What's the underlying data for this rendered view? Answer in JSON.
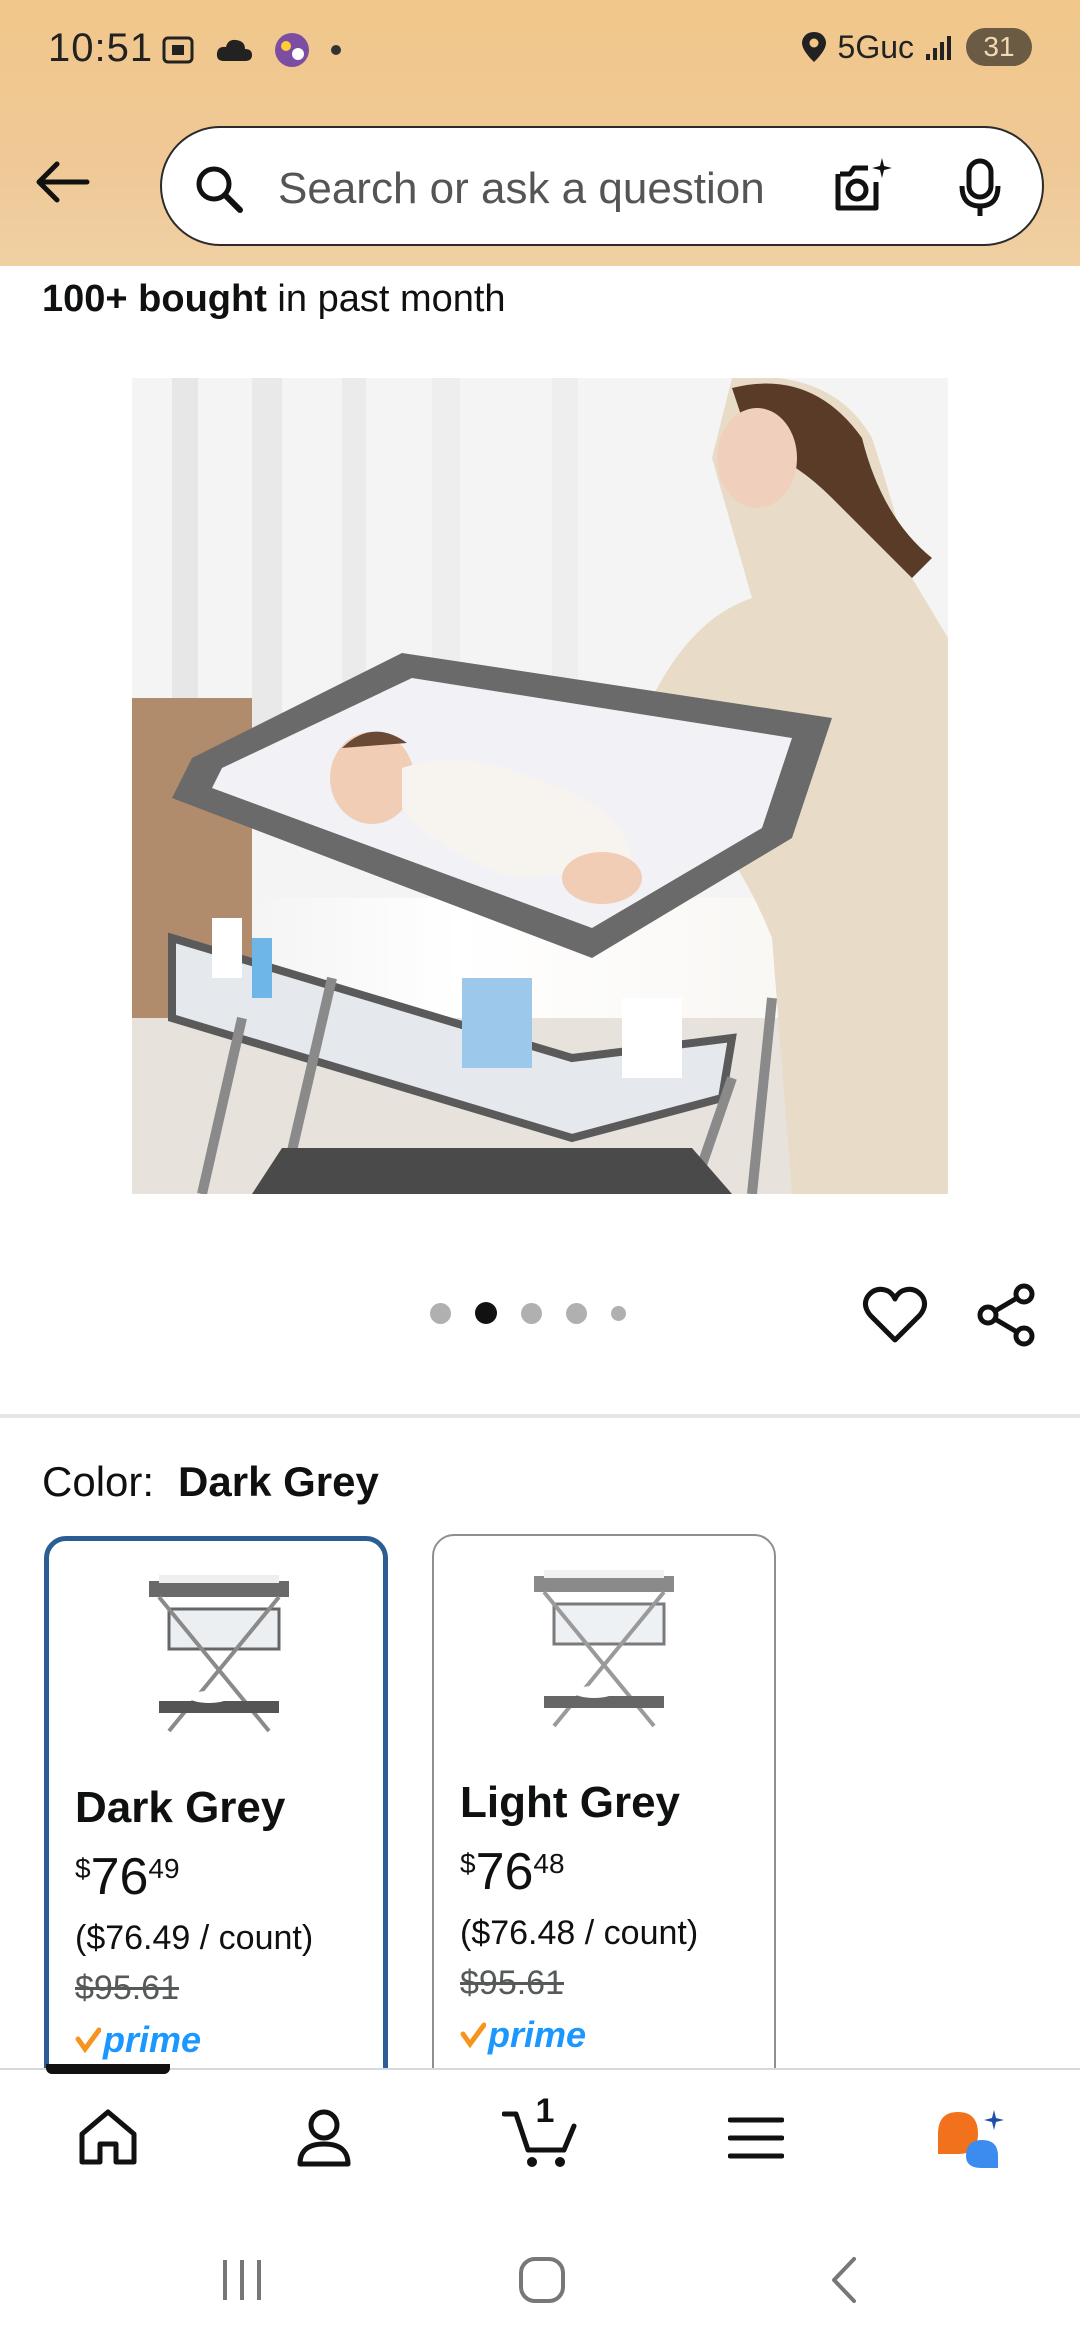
{
  "status_bar": {
    "time": "10:51",
    "network": "5Guc",
    "battery": "31"
  },
  "header": {
    "search_placeholder": "Search or ask a question"
  },
  "product": {
    "bought_bold": "100+ bought",
    "bought_rest": " in past month",
    "image_count": 5,
    "active_image_index": 1
  },
  "color_selector": {
    "label": "Color:",
    "selected_value": "Dark Grey",
    "options": [
      {
        "name": "Dark Grey",
        "price_symbol": "$",
        "price_whole": "76",
        "price_cents": "49",
        "unit_price": "($76.49 / count)",
        "list_price": "$95.61",
        "prime": "prime",
        "selected": true
      },
      {
        "name": "Light Grey",
        "price_symbol": "$",
        "price_whole": "76",
        "price_cents": "48",
        "unit_price": "($76.48 / count)",
        "list_price": "$95.61",
        "prime": "prime",
        "selected": false
      }
    ]
  },
  "tab_bar": {
    "cart_count": "1",
    "items": [
      "home-icon",
      "account-icon",
      "cart-icon",
      "menu-icon",
      "rufus-icon"
    ]
  },
  "colors": {
    "header_bg": "#f1c78a",
    "selected_border": "#2c5c94",
    "prime_blue": "#1a98ff",
    "prime_check": "#f7941d",
    "rufus_orange": "#f2711c",
    "rufus_blue": "#3c8cf0"
  }
}
